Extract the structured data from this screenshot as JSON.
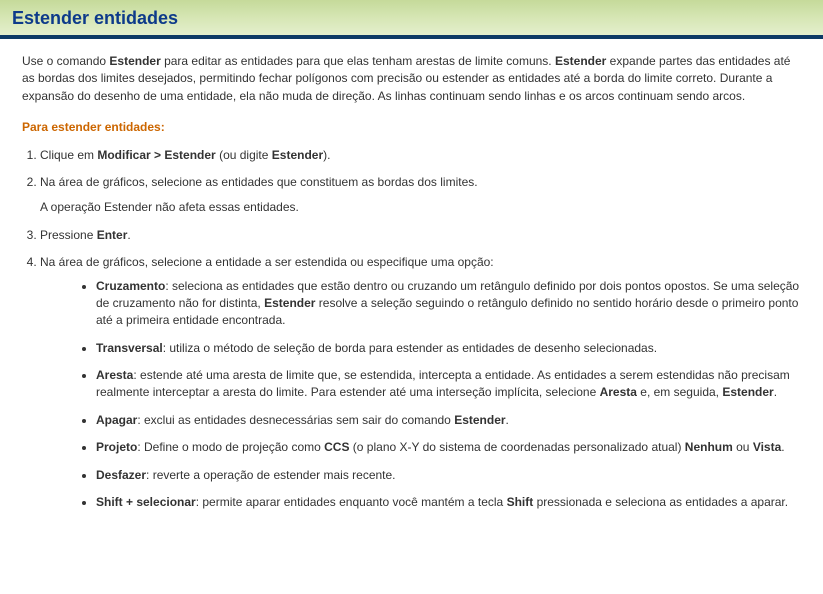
{
  "header": {
    "title": "Estender entidades"
  },
  "intro": {
    "t1": "Use o comando ",
    "b1": "Estender",
    "t2": " para editar as entidades para que elas tenham arestas de limite comuns. ",
    "b2": "Estender",
    "t3": " expande partes das entidades até as bordas dos limites desejados, permitindo fechar polígonos com precisão ou estender as entidades até a borda do limite correto. Durante a expansão do desenho de uma entidade, ela não muda de direção. As linhas continuam sendo linhas e os arcos continuam sendo arcos."
  },
  "section_label": "Para estender entidades:",
  "steps": {
    "s1": {
      "t1": "Clique em ",
      "b1": "Modificar > Estender",
      "t2": " (ou digite ",
      "b2": "Estender",
      "t3": ")."
    },
    "s2": {
      "line1": "Na área de gráficos, selecione as entidades que constituem as bordas dos limites.",
      "line2": "A operação Estender não afeta essas entidades."
    },
    "s3": {
      "t1": "Pressione ",
      "b1": "Enter",
      "t2": "."
    },
    "s4": {
      "line1": "Na área de gráficos, selecione a entidade a ser estendida ou especifique uma opção:"
    }
  },
  "options": {
    "o1": {
      "b1": "Cruzamento",
      "t1": ": seleciona as entidades que estão dentro ou cruzando um retângulo definido por dois pontos opostos. Se uma seleção de cruzamento não for distinta, ",
      "b2": "Estender",
      "t2": " resolve a seleção seguindo o retângulo definido no sentido horário desde o primeiro ponto até a primeira entidade encontrada."
    },
    "o2": {
      "b1": "Transversal",
      "t1": ": utiliza o método de seleção de borda para estender as entidades de desenho selecionadas."
    },
    "o3": {
      "b1": "Aresta",
      "t1": ": estende até uma aresta de limite que, se estendida, intercepta a entidade. As entidades a serem estendidas não precisam realmente interceptar a aresta do limite. Para estender até uma interseção implícita, selecione ",
      "b2": "Aresta",
      "t2": " e, em seguida, ",
      "b3": "Estender",
      "t3": "."
    },
    "o4": {
      "b1": "Apagar",
      "t1": ": exclui as entidades desnecessárias sem sair do comando ",
      "b2": "Estender",
      "t2": "."
    },
    "o5": {
      "b1": "Projeto",
      "t1": ": Define o modo de projeção como ",
      "b2": "CCS",
      "t2": " (o plano X-Y do sistema de coordenadas personalizado atual) ",
      "b3": "Nenhum",
      "t3": " ou ",
      "b4": "Vista",
      "t4": "."
    },
    "o6": {
      "b1": "Desfazer",
      "t1": ": reverte a operação de estender mais recente."
    },
    "o7": {
      "b1": "Shift + selecionar",
      "t1": ": permite aparar entidades enquanto você mantém a tecla ",
      "b2": "Shift",
      "t2": " pressionada e seleciona as entidades a aparar."
    }
  }
}
